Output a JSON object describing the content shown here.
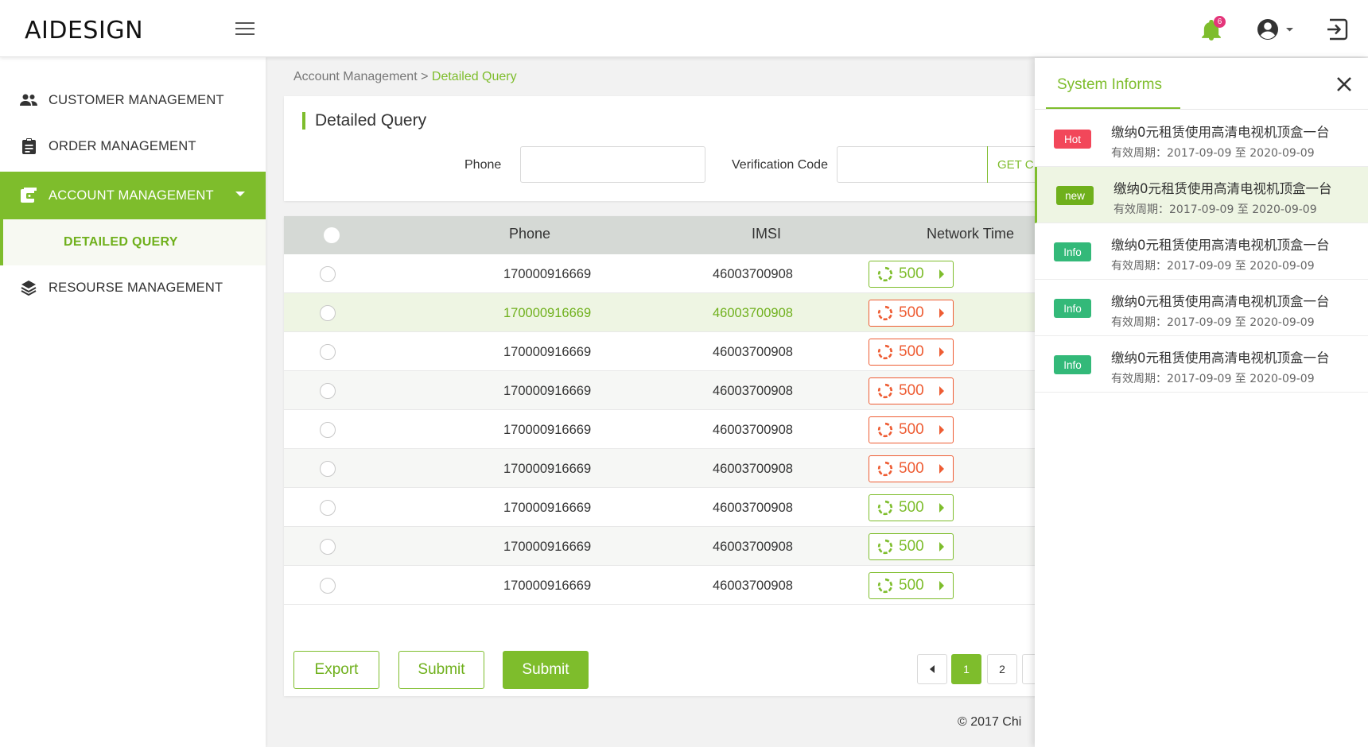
{
  "header": {
    "logo": "AIDESIGN",
    "notification_count": "6"
  },
  "sidebar": {
    "items": [
      {
        "label": "CUSTOMER MANAGEMENT",
        "icon": "people-icon"
      },
      {
        "label": "ORDER MANAGEMENT",
        "icon": "clipboard-icon"
      },
      {
        "label": "ACCOUNT MANAGEMENT",
        "icon": "wallet-icon",
        "active": true
      },
      {
        "label": "RESOURSE MANAGEMENT",
        "icon": "layers-icon"
      }
    ],
    "sub_item": "DETAILED QUERY"
  },
  "breadcrumb": {
    "parent": "Account Management",
    "separator": ">",
    "current": "Detailed Query"
  },
  "query": {
    "title": "Detailed Query",
    "phone_label": "Phone",
    "phone_value": "",
    "code_label": "Verification Code",
    "code_value": "",
    "get_code_label": "GET C"
  },
  "table": {
    "columns": [
      "Phone",
      "IMSI",
      "Network Time"
    ],
    "rows": [
      {
        "phone": "170000916669",
        "imsi": "46003700908",
        "network_time": "500",
        "status": "green"
      },
      {
        "phone": "170000916669",
        "imsi": "46003700908",
        "network_time": "500",
        "status": "red"
      },
      {
        "phone": "170000916669",
        "imsi": "46003700908",
        "network_time": "500",
        "status": "red"
      },
      {
        "phone": "170000916669",
        "imsi": "46003700908",
        "network_time": "500",
        "status": "red"
      },
      {
        "phone": "170000916669",
        "imsi": "46003700908",
        "network_time": "500",
        "status": "red"
      },
      {
        "phone": "170000916669",
        "imsi": "46003700908",
        "network_time": "500",
        "status": "red"
      },
      {
        "phone": "170000916669",
        "imsi": "46003700908",
        "network_time": "500",
        "status": "green"
      },
      {
        "phone": "170000916669",
        "imsi": "46003700908",
        "network_time": "500",
        "status": "green"
      },
      {
        "phone": "170000916669",
        "imsi": "46003700908",
        "network_time": "500",
        "status": "green"
      }
    ]
  },
  "actions": {
    "export_label": "Export",
    "submit_label": "Submit",
    "submit_primary_label": "Submit"
  },
  "pagination": {
    "pages": [
      "1",
      "2"
    ],
    "current": "1"
  },
  "footer": {
    "text": "2017 Chi"
  },
  "notifications": {
    "tab_label": "System Informs",
    "items": [
      {
        "tag": "Hot",
        "tag_color": "#f2475a",
        "title": "缴纳0元租赁使用高清电视机顶盒一台",
        "date": "有效周期：2017-09-09 至 2020-09-09"
      },
      {
        "tag": "new",
        "tag_color": "#6fb01c",
        "title": "缴纳0元租赁使用高清电视机顶盒一台",
        "date": "有效周期：2017-09-09 至 2020-09-09"
      },
      {
        "tag": "Info",
        "tag_color": "#33b979",
        "title": "缴纳0元租赁使用高清电视机顶盒一台",
        "date": "有效周期：2017-09-09 至 2020-09-09"
      },
      {
        "tag": "Info",
        "tag_color": "#33b979",
        "title": "缴纳0元租赁使用高清电视机顶盒一台",
        "date": "有效周期：2017-09-09 至 2020-09-09"
      },
      {
        "tag": "Info",
        "tag_color": "#33b979",
        "title": "缴纳0元租赁使用高清电视机顶盒一台",
        "date": "有效周期：2017-09-09 至 2020-09-09"
      }
    ]
  },
  "colors": {
    "accent": "#7ebd2c",
    "danger": "#ee5c33"
  }
}
